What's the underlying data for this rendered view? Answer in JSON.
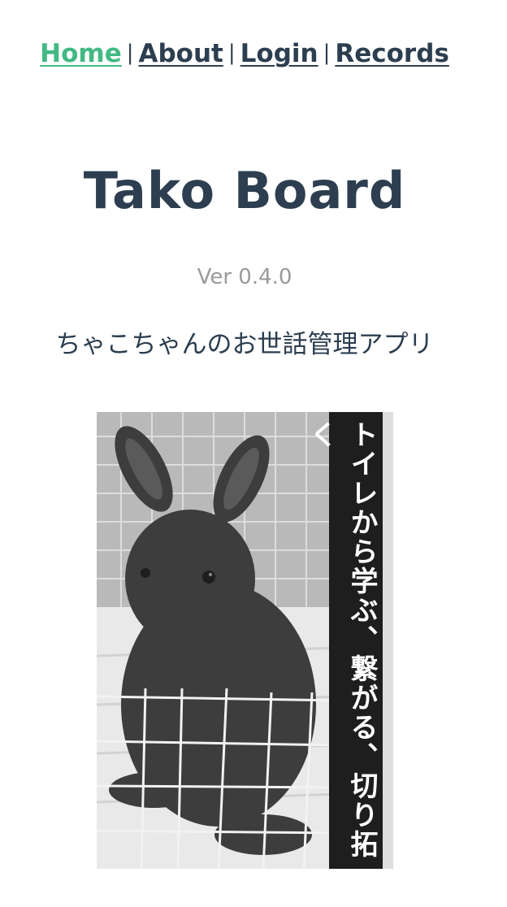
{
  "nav": {
    "items": [
      {
        "label": "Home",
        "active": true
      },
      {
        "label": "About",
        "active": false
      },
      {
        "label": "Login",
        "active": false
      },
      {
        "label": "Records",
        "active": false
      }
    ],
    "separator": "|"
  },
  "title": "Tako Board",
  "version": "Ver 0.4.0",
  "subtitle": "ちゃこちゃんのお世話管理アプリ",
  "photo": {
    "caption_vertical": "トイレから学ぶ、繋がる、切り拓く"
  },
  "colors": {
    "text": "#2c3e50",
    "active_link": "#42b983",
    "version": "#9a9a9a"
  }
}
